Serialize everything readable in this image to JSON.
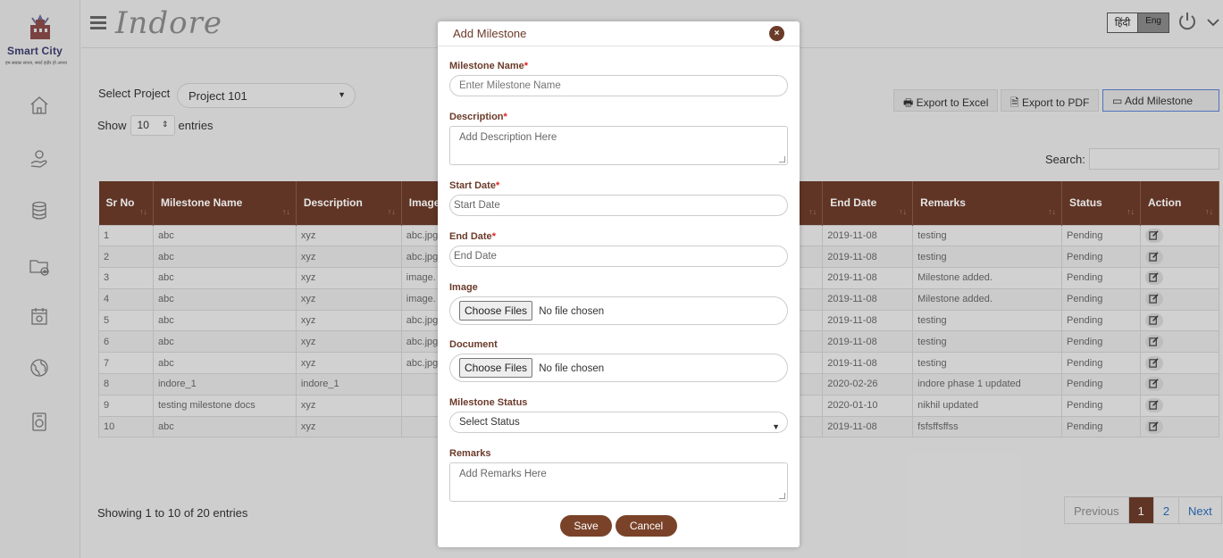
{
  "logo": {
    "name": "Smart City",
    "tagline": "हम सबका सपना, स्मार्ट इंदौर हो अपना"
  },
  "header": {
    "brand": "Indore",
    "lang_hi": "हिंदी",
    "lang_en": "Eng"
  },
  "sidebar": {
    "icons": [
      "home-icon",
      "hand-coin-icon",
      "database-icon",
      "folder-add-icon",
      "calendar-icon",
      "globe-icon",
      "report-icon"
    ]
  },
  "filters": {
    "select_project_label": "Select Project",
    "project": "Project 101",
    "show_label": "Show",
    "entries_value": "10",
    "entries_label": "entries",
    "search_label": "Search:"
  },
  "toolbar": {
    "export_excel": "Export to Excel",
    "export_pdf": "Export to PDF",
    "add_milestone": "Add Milestone"
  },
  "table": {
    "headers": [
      "Sr No",
      "Milestone Name",
      "Description",
      "Image",
      "",
      "End Date",
      "Remarks",
      "Status",
      "Action"
    ],
    "rows": [
      [
        "1",
        "abc",
        "xyz",
        "abc.jpg",
        "2019-11-08",
        "testing",
        "Pending"
      ],
      [
        "2",
        "abc",
        "xyz",
        "abc.jpg",
        "2019-11-08",
        "testing",
        "Pending"
      ],
      [
        "3",
        "abc",
        "xyz",
        "image.",
        "2019-11-08",
        "Milestone added.",
        "Pending"
      ],
      [
        "4",
        "abc",
        "xyz",
        "image.",
        "2019-11-08",
        "Milestone added.",
        "Pending"
      ],
      [
        "5",
        "abc",
        "xyz",
        "abc.jpg",
        "2019-11-08",
        "testing",
        "Pending"
      ],
      [
        "6",
        "abc",
        "xyz",
        "abc.jpg",
        "2019-11-08",
        "testing",
        "Pending"
      ],
      [
        "7",
        "abc",
        "xyz",
        "abc.jpg",
        "2019-11-08",
        "testing",
        "Pending"
      ],
      [
        "8",
        "indore_1",
        "indore_1",
        "",
        "2020-02-26",
        "indore phase 1 updated",
        "Pending"
      ],
      [
        "9",
        "testing milestone docs",
        "xyz",
        "",
        "2020-01-10",
        "nikhil updated",
        "Pending"
      ],
      [
        "10",
        "abc",
        "xyz",
        "",
        "2019-11-08",
        "fsfsffsffss",
        "Pending"
      ]
    ]
  },
  "footer": {
    "showing": "Showing 1 to 10 of 20 entries",
    "prev": "Previous",
    "page1": "1",
    "page2": "2",
    "next": "Next"
  },
  "modal": {
    "title": "Add Milestone",
    "close": "×",
    "milestone_name_label": "Milestone Name",
    "milestone_name_placeholder": "Enter Milestone Name",
    "description_label": "Description",
    "description_placeholder": "Add Description Here",
    "start_date_label": "Start Date",
    "start_date_placeholder": "Start Date",
    "end_date_label": "End Date",
    "end_date_placeholder": "End Date",
    "image_label": "Image",
    "document_label": "Document",
    "choose_files": "Choose Files",
    "no_file": "No file chosen",
    "status_label": "Milestone Status",
    "status_value": "Select Status",
    "remarks_label": "Remarks",
    "remarks_placeholder": "Add Remarks Here",
    "save": "Save",
    "cancel": "Cancel",
    "required_mark": "*"
  },
  "colors": {
    "brand_brown": "#6b3b2a",
    "accent_blue": "#2a6bb8",
    "required_red": "#dd2222"
  }
}
